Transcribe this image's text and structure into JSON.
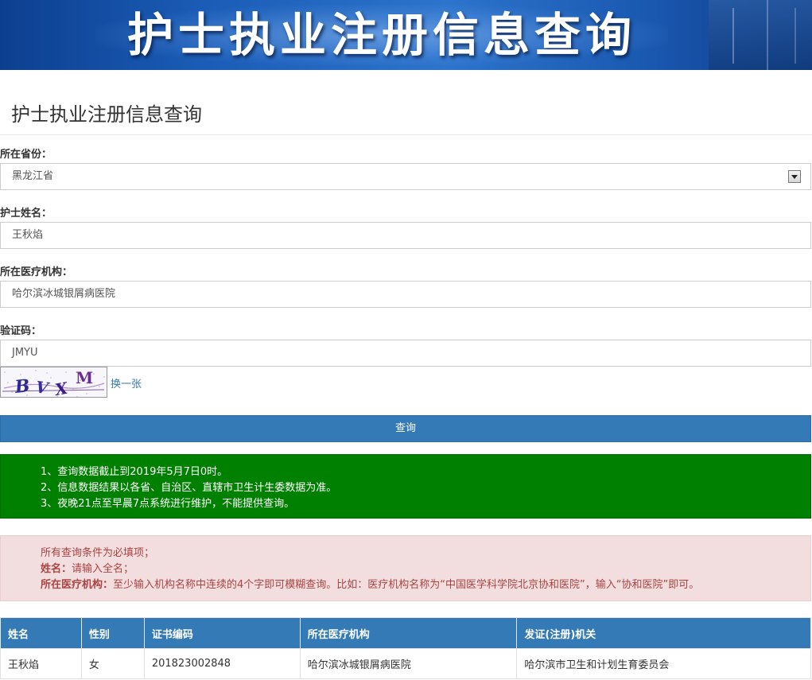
{
  "banner": {
    "title": "护士执业注册信息查询"
  },
  "page_title": "护士执业注册信息查询",
  "form": {
    "province": {
      "label": "所在省份：",
      "value": "黑龙江省"
    },
    "nurse_name": {
      "label": "护士姓名：",
      "value": "王秋焰"
    },
    "institution": {
      "label": "所在医疗机构：",
      "value": "哈尔滨冰城银屑病医院"
    },
    "captcha": {
      "label": "验证码：",
      "value": "JMYU",
      "image_text": "BVXM",
      "refresh_link": "换一张"
    },
    "submit_label": "查询"
  },
  "notices": {
    "info": [
      "1、查询数据截止到2019年5月7日0时。",
      "2、信息数据结果以各省、自治区、直辖市卫生计生委数据为准。",
      "3、夜晚21点至早晨7点系统进行维护，不能提供查询。"
    ],
    "warning": {
      "line1": "所有查询条件为必填项；",
      "line2_label": "姓名：",
      "line2_text": "请输入全名；",
      "line3_label": "所在医疗机构：",
      "line3_text": "至少输入机构名称中连续的4个字即可模糊查询。比如：医疗机构名称为“中国医学科学院北京协和医院”，输入“协和医院”即可。"
    }
  },
  "results": {
    "headers": [
      "姓名",
      "性别",
      "证书编码",
      "所在医疗机构",
      "发证(注册)机关"
    ],
    "rows": [
      [
        "王秋焰",
        "女",
        "201823002848",
        "哈尔滨冰城银屑病医院",
        "哈尔滨市卫生和计划生育委员会"
      ]
    ]
  },
  "colors": {
    "primary": "#337ab7",
    "success": "#008000",
    "danger_bg": "#f2dede",
    "danger_text": "#a94442"
  }
}
